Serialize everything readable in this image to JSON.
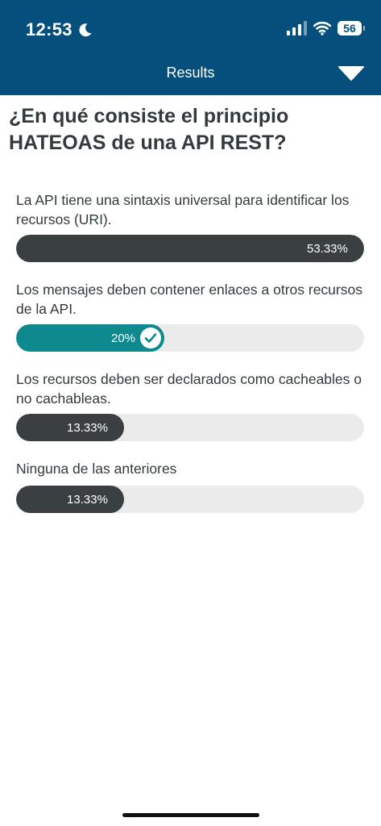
{
  "status_bar": {
    "time": "12:53",
    "battery": "56",
    "icons": [
      "moon-icon",
      "cellular-signal-icon",
      "wifi-icon",
      "battery-icon"
    ]
  },
  "header": {
    "title": "Results",
    "dropdown_icon": "chevron-down-icon",
    "background_color": "#054f7c"
  },
  "question": "¿En qué consiste el principio HATEOAS de una API REST?",
  "options": [
    {
      "label": "La API tiene una sintaxis universal para identificar los recursos (URI).",
      "percent_label": "53.33%",
      "fraction": 0.9997,
      "correct": false
    },
    {
      "label": "Los mensajes deben contener enlaces a otros recursos de la API.",
      "percent_label": "20%",
      "fraction": 0.426,
      "correct": true
    },
    {
      "label": "Los recursos deben ser declarados como cacheables o no cachableas.",
      "percent_label": "13.33%",
      "fraction": 0.31,
      "correct": false
    },
    {
      "label": "Ninguna de las anteriores",
      "percent_label": "13.33%",
      "fraction": 0.31,
      "correct": false
    }
  ],
  "colors": {
    "bar_fill": "#3a4042",
    "bar_correct": "#0e8a8f",
    "bar_track": "#ebebeb"
  }
}
